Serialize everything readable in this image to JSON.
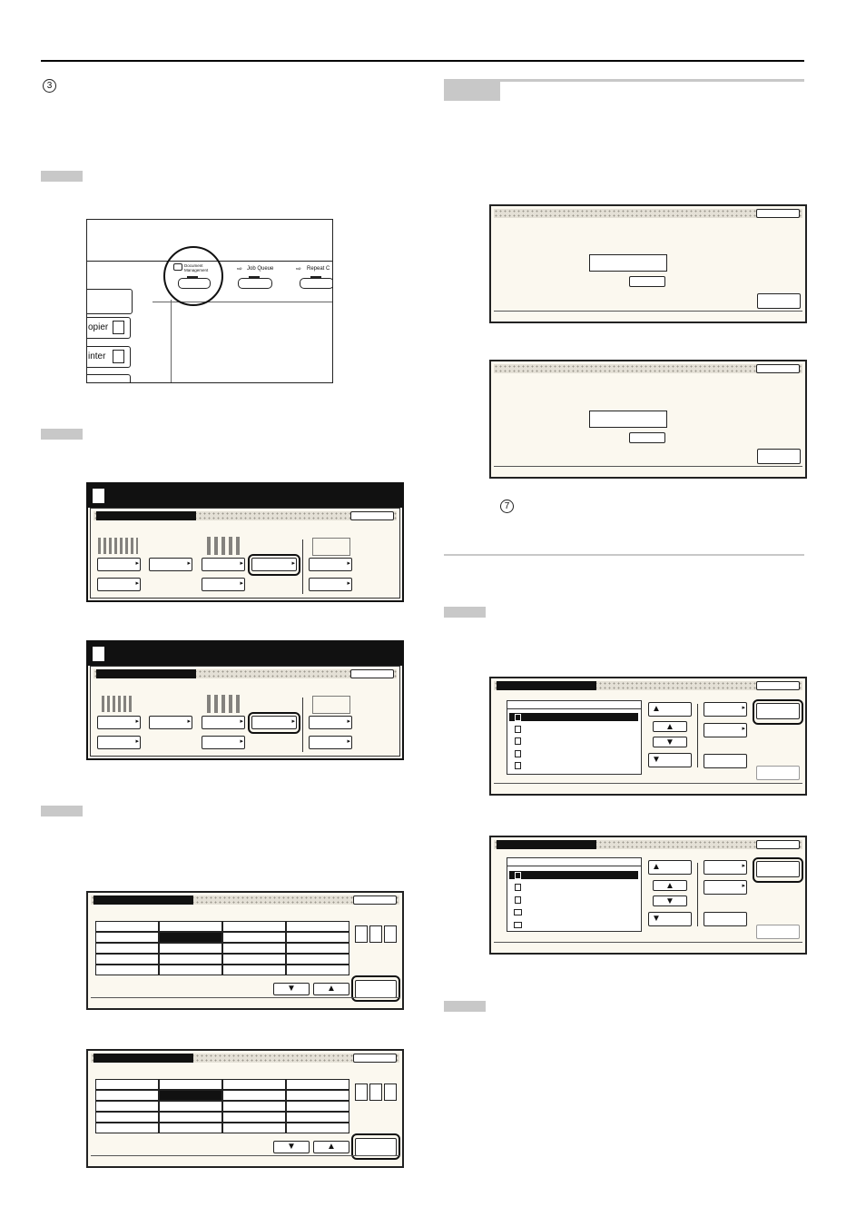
{
  "markers": {
    "step3": "3",
    "step7": "7"
  },
  "machine_panel": {
    "document_management_label_1": "Document",
    "document_management_label_2": "Management",
    "job_queue_label": "Job Queue",
    "repeat_copy_label": "Repeat C",
    "copier_label": "opier",
    "printer_label": "inter"
  },
  "icons": {
    "step_marker": "circled-number",
    "panel_icon": "document-icon"
  }
}
